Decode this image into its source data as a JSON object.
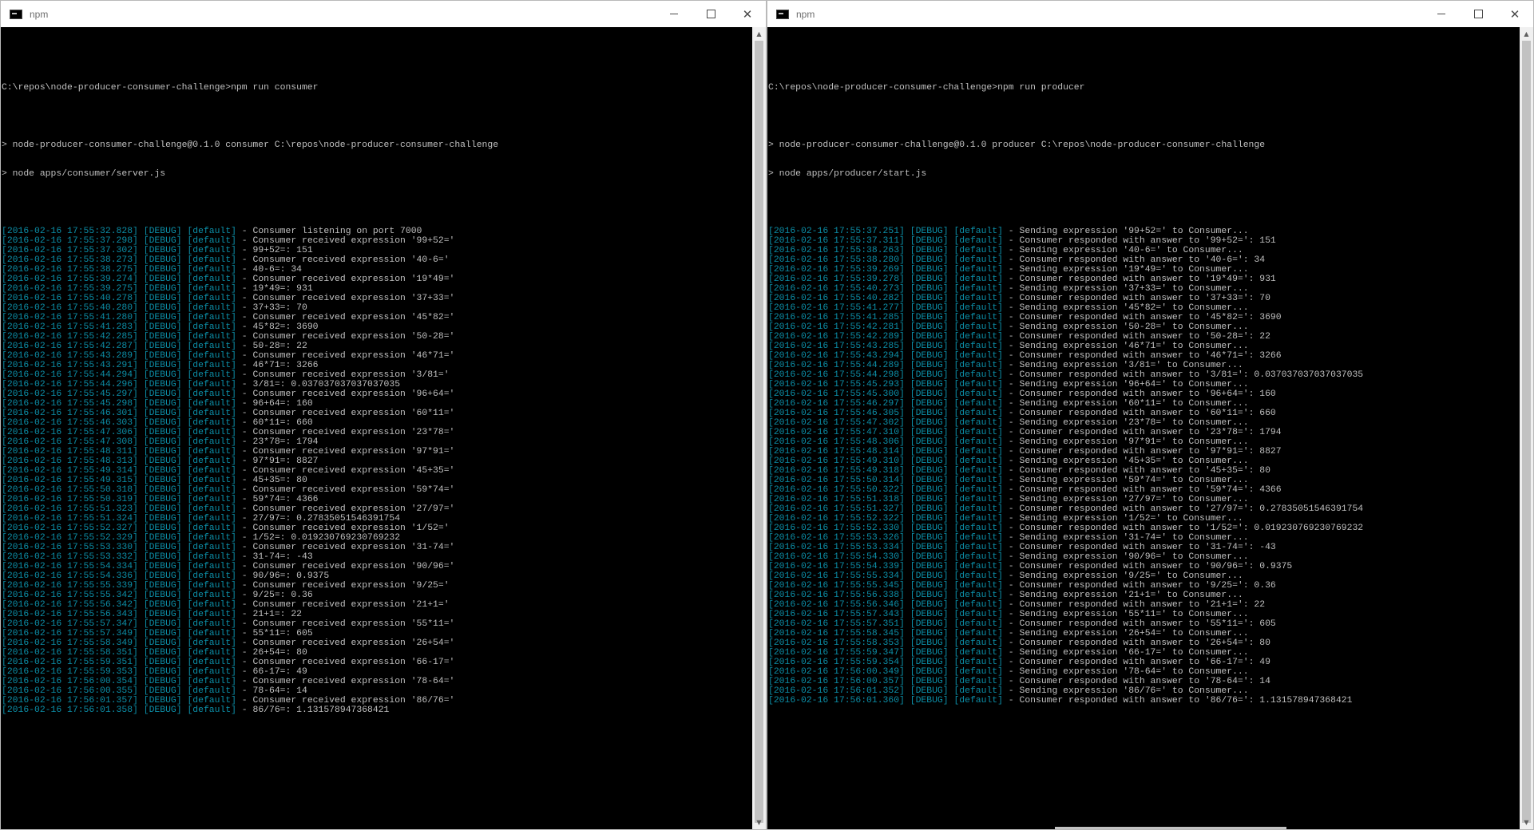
{
  "windows": [
    {
      "id": "consumer",
      "title": "npm",
      "prompt": "C:\\repos\\node-producer-consumer-challenge>npm run consumer",
      "pkg_line": "> node-producer-consumer-challenge@0.1.0 consumer C:\\repos\\node-producer-consumer-challenge",
      "cmd_line": "> node apps/consumer/server.js",
      "logs": [
        {
          "ts": "[2016-02-16 17:55:32.828]",
          "msg": "Consumer listening on port 7000"
        },
        {
          "ts": "[2016-02-16 17:55:37.298]",
          "msg": "Consumer received expression '99+52='"
        },
        {
          "ts": "[2016-02-16 17:55:37.302]",
          "msg": "99+52=: 151"
        },
        {
          "ts": "[2016-02-16 17:55:38.273]",
          "msg": "Consumer received expression '40-6='"
        },
        {
          "ts": "[2016-02-16 17:55:38.275]",
          "msg": "40-6=: 34"
        },
        {
          "ts": "[2016-02-16 17:55:39.274]",
          "msg": "Consumer received expression '19*49='"
        },
        {
          "ts": "[2016-02-16 17:55:39.275]",
          "msg": "19*49=: 931"
        },
        {
          "ts": "[2016-02-16 17:55:40.278]",
          "msg": "Consumer received expression '37+33='"
        },
        {
          "ts": "[2016-02-16 17:55:40.280]",
          "msg": "37+33=: 70"
        },
        {
          "ts": "[2016-02-16 17:55:41.280]",
          "msg": "Consumer received expression '45*82='"
        },
        {
          "ts": "[2016-02-16 17:55:41.283]",
          "msg": "45*82=: 3690"
        },
        {
          "ts": "[2016-02-16 17:55:42.285]",
          "msg": "Consumer received expression '50-28='"
        },
        {
          "ts": "[2016-02-16 17:55:42.287]",
          "msg": "50-28=: 22"
        },
        {
          "ts": "[2016-02-16 17:55:43.289]",
          "msg": "Consumer received expression '46*71='"
        },
        {
          "ts": "[2016-02-16 17:55:43.291]",
          "msg": "46*71=: 3266"
        },
        {
          "ts": "[2016-02-16 17:55:44.294]",
          "msg": "Consumer received expression '3/81='"
        },
        {
          "ts": "[2016-02-16 17:55:44.296]",
          "msg": "3/81=: 0.037037037037037035"
        },
        {
          "ts": "[2016-02-16 17:55:45.297]",
          "msg": "Consumer received expression '96+64='"
        },
        {
          "ts": "[2016-02-16 17:55:45.298]",
          "msg": "96+64=: 160"
        },
        {
          "ts": "[2016-02-16 17:55:46.301]",
          "msg": "Consumer received expression '60*11='"
        },
        {
          "ts": "[2016-02-16 17:55:46.303]",
          "msg": "60*11=: 660"
        },
        {
          "ts": "[2016-02-16 17:55:47.306]",
          "msg": "Consumer received expression '23*78='"
        },
        {
          "ts": "[2016-02-16 17:55:47.308]",
          "msg": "23*78=: 1794"
        },
        {
          "ts": "[2016-02-16 17:55:48.311]",
          "msg": "Consumer received expression '97*91='"
        },
        {
          "ts": "[2016-02-16 17:55:48.313]",
          "msg": "97*91=: 8827"
        },
        {
          "ts": "[2016-02-16 17:55:49.314]",
          "msg": "Consumer received expression '45+35='"
        },
        {
          "ts": "[2016-02-16 17:55:49.315]",
          "msg": "45+35=: 80"
        },
        {
          "ts": "[2016-02-16 17:55:50.318]",
          "msg": "Consumer received expression '59*74='"
        },
        {
          "ts": "[2016-02-16 17:55:50.319]",
          "msg": "59*74=: 4366"
        },
        {
          "ts": "[2016-02-16 17:55:51.323]",
          "msg": "Consumer received expression '27/97='"
        },
        {
          "ts": "[2016-02-16 17:55:51.324]",
          "msg": "27/97=: 0.27835051546391754"
        },
        {
          "ts": "[2016-02-16 17:55:52.327]",
          "msg": "Consumer received expression '1/52='"
        },
        {
          "ts": "[2016-02-16 17:55:52.329]",
          "msg": "1/52=: 0.019230769230769232"
        },
        {
          "ts": "[2016-02-16 17:55:53.330]",
          "msg": "Consumer received expression '31-74='"
        },
        {
          "ts": "[2016-02-16 17:55:53.332]",
          "msg": "31-74=: -43"
        },
        {
          "ts": "[2016-02-16 17:55:54.334]",
          "msg": "Consumer received expression '90/96='"
        },
        {
          "ts": "[2016-02-16 17:55:54.336]",
          "msg": "90/96=: 0.9375"
        },
        {
          "ts": "[2016-02-16 17:55:55.339]",
          "msg": "Consumer received expression '9/25='"
        },
        {
          "ts": "[2016-02-16 17:55:55.342]",
          "msg": "9/25=: 0.36"
        },
        {
          "ts": "[2016-02-16 17:55:56.342]",
          "msg": "Consumer received expression '21+1='"
        },
        {
          "ts": "[2016-02-16 17:55:56.343]",
          "msg": "21+1=: 22"
        },
        {
          "ts": "[2016-02-16 17:55:57.347]",
          "msg": "Consumer received expression '55*11='"
        },
        {
          "ts": "[2016-02-16 17:55:57.349]",
          "msg": "55*11=: 605"
        },
        {
          "ts": "[2016-02-16 17:55:58.349]",
          "msg": "Consumer received expression '26+54='"
        },
        {
          "ts": "[2016-02-16 17:55:58.351]",
          "msg": "26+54=: 80"
        },
        {
          "ts": "[2016-02-16 17:55:59.351]",
          "msg": "Consumer received expression '66-17='"
        },
        {
          "ts": "[2016-02-16 17:55:59.353]",
          "msg": "66-17=: 49"
        },
        {
          "ts": "[2016-02-16 17:56:00.354]",
          "msg": "Consumer received expression '78-64='"
        },
        {
          "ts": "[2016-02-16 17:56:00.355]",
          "msg": "78-64=: 14"
        },
        {
          "ts": "[2016-02-16 17:56:01.357]",
          "msg": "Consumer received expression '86/76='"
        },
        {
          "ts": "[2016-02-16 17:56:01.358]",
          "msg": "86/76=: 1.131578947368421"
        }
      ]
    },
    {
      "id": "producer",
      "title": "npm",
      "prompt": "C:\\repos\\node-producer-consumer-challenge>npm run producer",
      "pkg_line": "> node-producer-consumer-challenge@0.1.0 producer C:\\repos\\node-producer-consumer-challenge",
      "cmd_line": "> node apps/producer/start.js",
      "logs": [
        {
          "ts": "[2016-02-16 17:55:37.251]",
          "msg": "Sending expression '99+52=' to Consumer..."
        },
        {
          "ts": "[2016-02-16 17:55:37.311]",
          "msg": "Consumer responded with answer to '99+52=': 151"
        },
        {
          "ts": "[2016-02-16 17:55:38.263]",
          "msg": "Sending expression '40-6=' to Consumer..."
        },
        {
          "ts": "[2016-02-16 17:55:38.280]",
          "msg": "Consumer responded with answer to '40-6=': 34"
        },
        {
          "ts": "[2016-02-16 17:55:39.269]",
          "msg": "Sending expression '19*49=' to Consumer..."
        },
        {
          "ts": "[2016-02-16 17:55:39.278]",
          "msg": "Consumer responded with answer to '19*49=': 931"
        },
        {
          "ts": "[2016-02-16 17:55:40.273]",
          "msg": "Sending expression '37+33=' to Consumer..."
        },
        {
          "ts": "[2016-02-16 17:55:40.282]",
          "msg": "Consumer responded with answer to '37+33=': 70"
        },
        {
          "ts": "[2016-02-16 17:55:41.277]",
          "msg": "Sending expression '45*82=' to Consumer..."
        },
        {
          "ts": "[2016-02-16 17:55:41.285]",
          "msg": "Consumer responded with answer to '45*82=': 3690"
        },
        {
          "ts": "[2016-02-16 17:55:42.281]",
          "msg": "Sending expression '50-28=' to Consumer..."
        },
        {
          "ts": "[2016-02-16 17:55:42.289]",
          "msg": "Consumer responded with answer to '50-28=': 22"
        },
        {
          "ts": "[2016-02-16 17:55:43.285]",
          "msg": "Sending expression '46*71=' to Consumer..."
        },
        {
          "ts": "[2016-02-16 17:55:43.294]",
          "msg": "Consumer responded with answer to '46*71=': 3266"
        },
        {
          "ts": "[2016-02-16 17:55:44.289]",
          "msg": "Sending expression '3/81=' to Consumer..."
        },
        {
          "ts": "[2016-02-16 17:55:44.298]",
          "msg": "Consumer responded with answer to '3/81=': 0.037037037037037035"
        },
        {
          "ts": "[2016-02-16 17:55:45.293]",
          "msg": "Sending expression '96+64=' to Consumer..."
        },
        {
          "ts": "[2016-02-16 17:55:45.300]",
          "msg": "Consumer responded with answer to '96+64=': 160"
        },
        {
          "ts": "[2016-02-16 17:55:46.297]",
          "msg": "Sending expression '60*11=' to Consumer..."
        },
        {
          "ts": "[2016-02-16 17:55:46.305]",
          "msg": "Consumer responded with answer to '60*11=': 660"
        },
        {
          "ts": "[2016-02-16 17:55:47.302]",
          "msg": "Sending expression '23*78=' to Consumer..."
        },
        {
          "ts": "[2016-02-16 17:55:47.310]",
          "msg": "Consumer responded with answer to '23*78=': 1794"
        },
        {
          "ts": "[2016-02-16 17:55:48.306]",
          "msg": "Sending expression '97*91=' to Consumer..."
        },
        {
          "ts": "[2016-02-16 17:55:48.314]",
          "msg": "Consumer responded with answer to '97*91=': 8827"
        },
        {
          "ts": "[2016-02-16 17:55:49.310]",
          "msg": "Sending expression '45+35=' to Consumer..."
        },
        {
          "ts": "[2016-02-16 17:55:49.318]",
          "msg": "Consumer responded with answer to '45+35=': 80"
        },
        {
          "ts": "[2016-02-16 17:55:50.314]",
          "msg": "Sending expression '59*74=' to Consumer..."
        },
        {
          "ts": "[2016-02-16 17:55:50.322]",
          "msg": "Consumer responded with answer to '59*74=': 4366"
        },
        {
          "ts": "[2016-02-16 17:55:51.318]",
          "msg": "Sending expression '27/97=' to Consumer..."
        },
        {
          "ts": "[2016-02-16 17:55:51.327]",
          "msg": "Consumer responded with answer to '27/97=': 0.27835051546391754"
        },
        {
          "ts": "[2016-02-16 17:55:52.322]",
          "msg": "Sending expression '1/52=' to Consumer..."
        },
        {
          "ts": "[2016-02-16 17:55:52.330]",
          "msg": "Consumer responded with answer to '1/52=': 0.019230769230769232"
        },
        {
          "ts": "[2016-02-16 17:55:53.326]",
          "msg": "Sending expression '31-74=' to Consumer..."
        },
        {
          "ts": "[2016-02-16 17:55:53.334]",
          "msg": "Consumer responded with answer to '31-74=': -43"
        },
        {
          "ts": "[2016-02-16 17:55:54.330]",
          "msg": "Sending expression '90/96=' to Consumer..."
        },
        {
          "ts": "[2016-02-16 17:55:54.339]",
          "msg": "Consumer responded with answer to '90/96=': 0.9375"
        },
        {
          "ts": "[2016-02-16 17:55:55.334]",
          "msg": "Sending expression '9/25=' to Consumer..."
        },
        {
          "ts": "[2016-02-16 17:55:55.345]",
          "msg": "Consumer responded with answer to '9/25=': 0.36"
        },
        {
          "ts": "[2016-02-16 17:55:56.338]",
          "msg": "Sending expression '21+1=' to Consumer..."
        },
        {
          "ts": "[2016-02-16 17:55:56.346]",
          "msg": "Consumer responded with answer to '21+1=': 22"
        },
        {
          "ts": "[2016-02-16 17:55:57.343]",
          "msg": "Sending expression '55*11=' to Consumer..."
        },
        {
          "ts": "[2016-02-16 17:55:57.351]",
          "msg": "Consumer responded with answer to '55*11=': 605"
        },
        {
          "ts": "[2016-02-16 17:55:58.345]",
          "msg": "Sending expression '26+54=' to Consumer..."
        },
        {
          "ts": "[2016-02-16 17:55:58.353]",
          "msg": "Consumer responded with answer to '26+54=': 80"
        },
        {
          "ts": "[2016-02-16 17:55:59.347]",
          "msg": "Sending expression '66-17=' to Consumer..."
        },
        {
          "ts": "[2016-02-16 17:55:59.354]",
          "msg": "Consumer responded with answer to '66-17=': 49"
        },
        {
          "ts": "[2016-02-16 17:56:00.349]",
          "msg": "Sending expression '78-64=' to Consumer..."
        },
        {
          "ts": "[2016-02-16 17:56:00.357]",
          "msg": "Consumer responded with answer to '78-64=': 14"
        },
        {
          "ts": "[2016-02-16 17:56:01.352]",
          "msg": "Sending expression '86/76=' to Consumer..."
        },
        {
          "ts": "[2016-02-16 17:56:01.360]",
          "msg": "Consumer responded with answer to '86/76=': 1.131578947368421"
        }
      ]
    }
  ],
  "log_level": "[DEBUG]",
  "log_category": "[default]",
  "log_separator": " - ",
  "colors": {
    "timestamp": "#0c8fa8",
    "text": "#c0c0c0",
    "background": "#000000"
  },
  "icons": {
    "app": "cmd-icon",
    "minimize": "minimize-icon",
    "maximize": "maximize-icon",
    "close": "close-icon"
  },
  "controls": {
    "close_glyph": "✕"
  }
}
